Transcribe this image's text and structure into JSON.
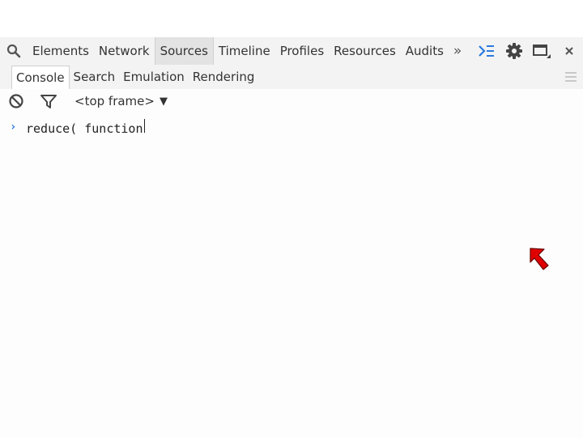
{
  "main_toolbar": {
    "tabs": [
      {
        "label": "Elements"
      },
      {
        "label": "Network"
      },
      {
        "label": "Sources"
      },
      {
        "label": "Timeline"
      },
      {
        "label": "Profiles"
      },
      {
        "label": "Resources"
      },
      {
        "label": "Audits"
      }
    ],
    "selected_tab": "Sources",
    "overflow_label": "»",
    "icons": [
      "search-icon",
      "console-drawer-icon",
      "gear-icon",
      "dock-icon",
      "close-icon"
    ]
  },
  "drawer": {
    "tabs": [
      {
        "label": "Console"
      },
      {
        "label": "Search"
      },
      {
        "label": "Emulation"
      },
      {
        "label": "Rendering"
      }
    ],
    "selected_tab": "Console"
  },
  "console_toolbar": {
    "frame_label": "<top frame>",
    "icons": [
      "clear-icon",
      "filter-icon"
    ]
  },
  "prompt": {
    "value": "reduce( function"
  },
  "colors": {
    "prompt_arrow": "#2b7bdf",
    "pointer": "#e00000"
  }
}
